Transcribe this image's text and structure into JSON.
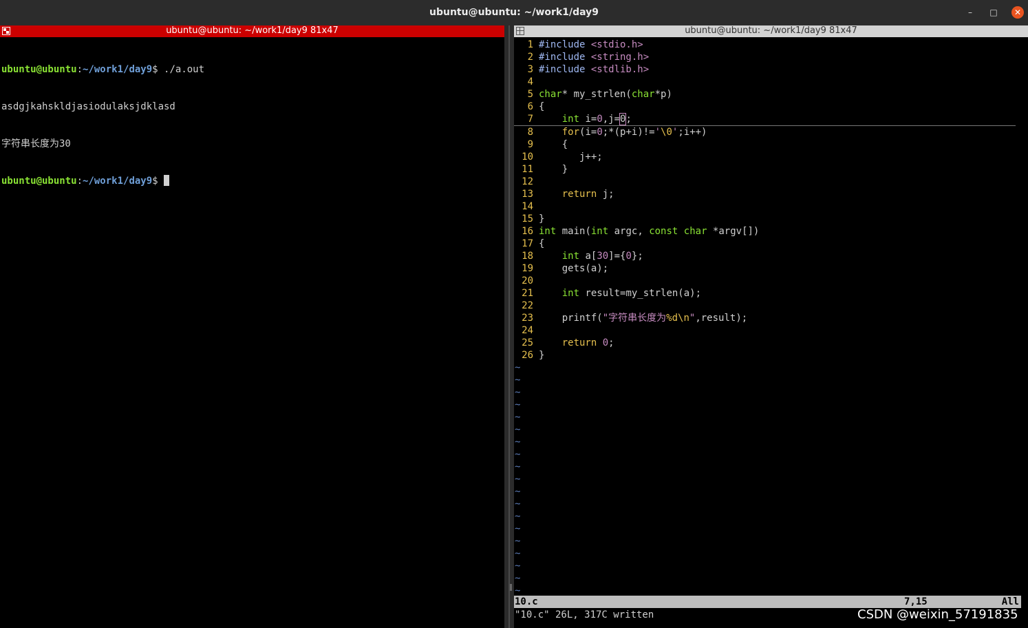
{
  "window": {
    "title": "ubuntu@ubuntu: ~/work1/day9"
  },
  "left_pane": {
    "title": "ubuntu@ubuntu: ~/work1/day9 81x47",
    "lines": [
      {
        "user": "ubuntu@ubuntu",
        "path": "~/work1/day9",
        "cmd": "$ ./a.out"
      },
      {
        "text": "asdgjkahskldjasiodulaksjdklasd"
      },
      {
        "text": "字符串长度为30"
      },
      {
        "user": "ubuntu@ubuntu",
        "path": "~/work1/day9",
        "cmd": "$ "
      }
    ],
    "colon": ":"
  },
  "right_pane": {
    "title": "ubuntu@ubuntu: ~/work1/day9 81x47",
    "code": [
      {
        "n": "1",
        "t": [
          [
            "pp",
            "#include "
          ],
          [
            "inc",
            "<stdio.h>"
          ]
        ]
      },
      {
        "n": "2",
        "t": [
          [
            "pp",
            "#include "
          ],
          [
            "inc",
            "<string.h>"
          ]
        ]
      },
      {
        "n": "3",
        "t": [
          [
            "pp",
            "#include "
          ],
          [
            "inc",
            "<stdlib.h>"
          ]
        ]
      },
      {
        "n": "4",
        "t": []
      },
      {
        "n": "5",
        "t": [
          [
            "ty",
            "char"
          ],
          [
            "",
            "* my_strlen("
          ],
          [
            "ty",
            "char"
          ],
          [
            "",
            "*p)"
          ]
        ]
      },
      {
        "n": "6",
        "t": [
          [
            "",
            "{"
          ]
        ]
      },
      {
        "n": "7",
        "t": [
          [
            "",
            "    "
          ],
          [
            "ty",
            "int"
          ],
          [
            "",
            " i="
          ],
          [
            "num",
            "0"
          ],
          [
            "",
            ",j="
          ],
          [
            "hl",
            "0"
          ],
          [
            "",
            ";"
          ]
        ],
        "current": true
      },
      {
        "n": "8",
        "t": [
          [
            "",
            "    "
          ],
          [
            "kw",
            "for"
          ],
          [
            "",
            "(i="
          ],
          [
            "num",
            "0"
          ],
          [
            "",
            ";*(p+i)!="
          ],
          [
            "st",
            "'"
          ],
          [
            "esc",
            "\\0"
          ],
          [
            "st",
            "'"
          ],
          [
            "",
            ";i++)"
          ]
        ]
      },
      {
        "n": "9",
        "t": [
          [
            "",
            "    {"
          ]
        ]
      },
      {
        "n": "10",
        "t": [
          [
            "",
            "       j++;"
          ]
        ]
      },
      {
        "n": "11",
        "t": [
          [
            "",
            "    }"
          ]
        ]
      },
      {
        "n": "12",
        "t": []
      },
      {
        "n": "13",
        "t": [
          [
            "",
            "    "
          ],
          [
            "kw",
            "return"
          ],
          [
            "",
            " j;"
          ]
        ]
      },
      {
        "n": "14",
        "t": []
      },
      {
        "n": "15",
        "t": [
          [
            "",
            "}"
          ]
        ]
      },
      {
        "n": "16",
        "t": [
          [
            "ty",
            "int"
          ],
          [
            "",
            " main("
          ],
          [
            "ty",
            "int"
          ],
          [
            "",
            " argc, "
          ],
          [
            "ty",
            "const"
          ],
          [
            "",
            " "
          ],
          [
            "ty",
            "char"
          ],
          [
            "",
            " *argv[])"
          ]
        ]
      },
      {
        "n": "17",
        "t": [
          [
            "",
            "{"
          ]
        ]
      },
      {
        "n": "18",
        "t": [
          [
            "",
            "    "
          ],
          [
            "ty",
            "int"
          ],
          [
            "",
            " a["
          ],
          [
            "num",
            "30"
          ],
          [
            "",
            "]={"
          ],
          [
            "num",
            "0"
          ],
          [
            "",
            "};"
          ]
        ]
      },
      {
        "n": "19",
        "t": [
          [
            "",
            "    gets(a);"
          ]
        ]
      },
      {
        "n": "20",
        "t": []
      },
      {
        "n": "21",
        "t": [
          [
            "",
            "    "
          ],
          [
            "ty",
            "int"
          ],
          [
            "",
            " result=my_strlen(a);"
          ]
        ]
      },
      {
        "n": "22",
        "t": []
      },
      {
        "n": "23",
        "t": [
          [
            "",
            "    printf("
          ],
          [
            "st",
            "\"字符串长度为"
          ],
          [
            "esc",
            "%d\\n"
          ],
          [
            "st",
            "\""
          ],
          [
            "",
            ",result);"
          ]
        ]
      },
      {
        "n": "24",
        "t": []
      },
      {
        "n": "25",
        "t": [
          [
            "",
            "    "
          ],
          [
            "kw",
            "return"
          ],
          [
            "",
            " "
          ],
          [
            "num",
            "0"
          ],
          [
            "",
            ";"
          ]
        ]
      },
      {
        "n": "26",
        "t": [
          [
            "",
            "}"
          ]
        ]
      }
    ],
    "tilde": "~",
    "tilde_count": 19,
    "status": {
      "file": "10.c",
      "position": "7,15",
      "scroll": "All"
    },
    "message": "\"10.c\" 26L, 317C written"
  },
  "watermark": "CSDN @weixin_57191835",
  "colors": {
    "accent": "#e95420",
    "pane_active": "#cc0000",
    "prompt_user": "#8ae234",
    "prompt_path": "#6f9fd8"
  }
}
